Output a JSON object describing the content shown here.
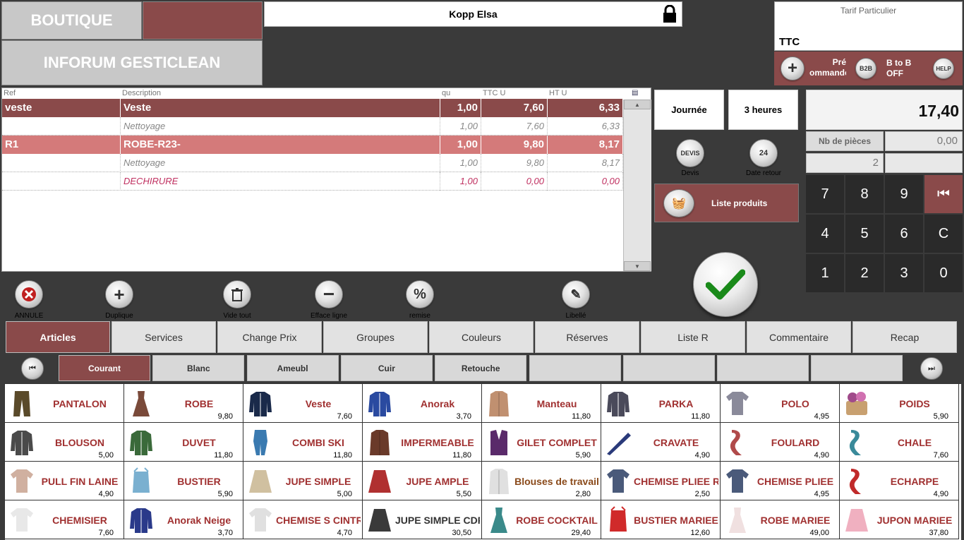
{
  "header": {
    "boutique_label": "BOUTIQUE",
    "company_label": "INFORUM GESTICLEAN",
    "client_name": "Kopp Elsa",
    "tarif_label": "Tarif Particulier",
    "tarif_value": "TTC",
    "pre_commande_label": "Pré\nommande",
    "b2b_icon_text": "B2B",
    "b2b_label": "B to B\nOFF",
    "help_icon_text": "HELP"
  },
  "grid": {
    "columns": [
      "Ref",
      "Description",
      "qu",
      "TTC U",
      "HT U"
    ],
    "rows": [
      {
        "type": "main1",
        "ref": "veste",
        "desc": "Veste",
        "qu": "1,00",
        "ttc": "7,60",
        "ht": "6,33"
      },
      {
        "type": "sub",
        "ref": "",
        "desc": "Nettoyage",
        "qu": "1,00",
        "ttc": "7,60",
        "ht": "6,33"
      },
      {
        "type": "main2",
        "ref": "R1",
        "desc": "ROBE-R23-",
        "qu": "1,00",
        "ttc": "9,80",
        "ht": "8,17"
      },
      {
        "type": "sub",
        "ref": "",
        "desc": "Nettoyage",
        "qu": "1,00",
        "ttc": "9,80",
        "ht": "8,17"
      },
      {
        "type": "def",
        "ref": "",
        "desc": "DECHIRURE",
        "qu": "1,00",
        "ttc": "0,00",
        "ht": "0,00"
      }
    ]
  },
  "modes": {
    "journee": "Journée",
    "trois_heures": "3 heures"
  },
  "devis": {
    "icon_text": "DEVIS",
    "caption": "Devis"
  },
  "date_retour": {
    "icon_text": "24",
    "caption": "Date retour"
  },
  "liste_produits": "Liste produits",
  "totals": {
    "total": "17,40",
    "nb_pieces_label": "Nb de pièces",
    "nb_pieces_value": "0,00",
    "count": "2"
  },
  "keypad": [
    "7",
    "8",
    "9",
    "⏮",
    "4",
    "5",
    "6",
    "C",
    "1",
    "2",
    "3",
    "0"
  ],
  "actions": {
    "annule": "ANNULE",
    "duplique": "Duplique",
    "vide_tout": "Vide tout",
    "efface_ligne": "Efface ligne",
    "remise": "remise",
    "libelle": "Libellé"
  },
  "tabs": [
    "Articles",
    "Services",
    "Change Prix",
    "Groupes",
    "Couleurs",
    "Réserves",
    "Liste R",
    "Commentaire",
    "Recap"
  ],
  "subtabs": [
    "Courant",
    "Blanc",
    "Ameubl",
    "Cuir",
    "Retouche",
    "",
    "",
    "",
    ""
  ],
  "products": [
    {
      "name": "PANTALON",
      "price": "",
      "color": "#5a4a2a",
      "shape": "pant"
    },
    {
      "name": "ROBE",
      "price": "9,80",
      "color": "#7a4a3a",
      "shape": "dress"
    },
    {
      "name": "Veste",
      "price": "7,60",
      "color": "#1a2a4a",
      "shape": "jacket"
    },
    {
      "name": "Anorak",
      "price": "3,70",
      "color": "#2a4aa0",
      "shape": "jacket"
    },
    {
      "name": "Manteau",
      "price": "11,80",
      "color": "#c09070",
      "shape": "coat"
    },
    {
      "name": "PARKA",
      "price": "11,80",
      "color": "#4a4a5a",
      "shape": "jacket"
    },
    {
      "name": "POLO",
      "price": "4,95",
      "color": "#8a8a9a",
      "shape": "shirt"
    },
    {
      "name": "POIDS",
      "price": "5,90",
      "color": "#a04a8a",
      "shape": "basket"
    },
    {
      "name": "BLOUSON",
      "price": "5,00",
      "color": "#4a4a4a",
      "shape": "jacket"
    },
    {
      "name": "DUVET",
      "price": "11,80",
      "color": "#3a6a3a",
      "shape": "jacket"
    },
    {
      "name": "COMBI SKI",
      "price": "11,80",
      "color": "#3a7ab0",
      "shape": "suit"
    },
    {
      "name": "IMPERMEABLE",
      "price": "11,80",
      "color": "#6a3a2a",
      "shape": "coat"
    },
    {
      "name": "GILET COMPLET",
      "price": "5,90",
      "color": "#5a2a6a",
      "shape": "vest"
    },
    {
      "name": "CRAVATE",
      "price": "4,90",
      "color": "#2a3a7a",
      "shape": "tie"
    },
    {
      "name": "FOULARD",
      "price": "4,90",
      "color": "#b04a4a",
      "shape": "scarf"
    },
    {
      "name": "CHALE",
      "price": "7,60",
      "color": "#3a8a9a",
      "shape": "scarf"
    },
    {
      "name": "PULL FIN LAINE",
      "price": "4,90",
      "color": "#d0b0a0",
      "shape": "shirt"
    },
    {
      "name": "BUSTIER",
      "price": "5,90",
      "color": "#7ab0d0",
      "shape": "top"
    },
    {
      "name": "JUPE SIMPLE",
      "price": "5,00",
      "color": "#d0c0a0",
      "shape": "skirt"
    },
    {
      "name": "JUPE AMPLE",
      "price": "5,50",
      "color": "#b03030",
      "shape": "skirt"
    },
    {
      "name": "Blouses de travail",
      "price": "2,80",
      "color": "#e0e0e0",
      "shape": "coat"
    },
    {
      "name": "CHEMISE PLIEE RS",
      "price": "2,50",
      "color": "#4a5a7a",
      "shape": "shirt"
    },
    {
      "name": "CHEMISE PLIEE",
      "price": "4,95",
      "color": "#4a5a7a",
      "shape": "shirt"
    },
    {
      "name": "ECHARPE",
      "price": "4,90",
      "color": "#c02a2a",
      "shape": "scarf"
    },
    {
      "name": "CHEMISIER",
      "price": "7,60",
      "color": "#e8e8e8",
      "shape": "shirt"
    },
    {
      "name": "Anorak Neige",
      "price": "3,70",
      "color": "#2a3a8a",
      "shape": "jacket"
    },
    {
      "name": "CHEMISE S CINTRE",
      "price": "4,70",
      "color": "#e0e0e0",
      "shape": "shirt"
    },
    {
      "name": "JUPE SIMPLE CDF",
      "price": "30,50",
      "color": "#3a3a3a",
      "shape": "skirt"
    },
    {
      "name": "ROBE COCKTAIL",
      "price": "29,40",
      "color": "#3a8a8a",
      "shape": "dress"
    },
    {
      "name": "BUSTIER MARIEE",
      "price": "12,60",
      "color": "#d02a2a",
      "shape": "top"
    },
    {
      "name": "ROBE MARIEE",
      "price": "49,00",
      "color": "#f0e0e0",
      "shape": "dress"
    },
    {
      "name": "JUPON MARIEE",
      "price": "37,80",
      "color": "#f0b0c0",
      "shape": "skirt"
    }
  ],
  "colors": {
    "accent": "#8a4a4a",
    "accent_light": "#d47a7a",
    "product_text": "#a03030",
    "keypad": "#2a2a2a"
  }
}
